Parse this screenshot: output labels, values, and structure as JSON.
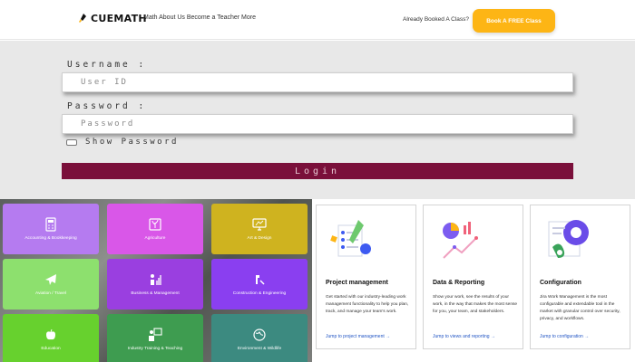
{
  "header": {
    "brand": "CUEMATH",
    "nav_text": "Math About Us Become a Teacher More",
    "question": "Already Booked A Class?",
    "book_label": "Book A FREE Class"
  },
  "login": {
    "username_label": "Username :",
    "username_placeholder": "User ID",
    "password_label": "Password :",
    "password_placeholder": "Password",
    "show_password": "Show Password",
    "login_label": "Login"
  },
  "tiles": [
    {
      "label": "Accounting & Bookkeeping",
      "color": "#b57bf0",
      "icon": "calculator-icon"
    },
    {
      "label": "Agriculture",
      "color": "#d957e8",
      "icon": "plant-icon"
    },
    {
      "label": "Art & Design",
      "color": "#cfb31f",
      "icon": "monitor-icon"
    },
    {
      "label": "Aviation / Travel",
      "color": "#8de06e",
      "icon": "airplane-icon"
    },
    {
      "label": "Business & Management",
      "color": "#9a3fe0",
      "icon": "chart-icon"
    },
    {
      "label": "Construction & Engineering",
      "color": "#8a3ff0",
      "icon": "tools-icon"
    },
    {
      "label": "Education",
      "color": "#67d12e",
      "icon": "apple-icon"
    },
    {
      "label": "Industry Training & Teaching",
      "color": "#3e9c50",
      "icon": "presentation-icon"
    },
    {
      "label": "Environment & Wildlife",
      "color": "#3c8a80",
      "icon": "globe-icon"
    }
  ],
  "cards": [
    {
      "title": "Project management",
      "desc": "Get started with our industry-leading work management functionality to help you plan, track, and manage your team's work.",
      "link": "Jump to project management →",
      "accent": "#3d5af1"
    },
    {
      "title": "Data & Reporting",
      "desc": "Show your work, see the results of your work, in the way that makes the most sense for you, your team, and stakeholders.",
      "link": "Jump to views and reporting →",
      "accent": "#7c5cf0"
    },
    {
      "title": "Configuration",
      "desc": "Jira Work Management is the most configurable and extendable tool in the market with granular control over security, privacy, and workflows.",
      "link": "Jump to configuration →",
      "accent": "#3aa35a"
    }
  ]
}
